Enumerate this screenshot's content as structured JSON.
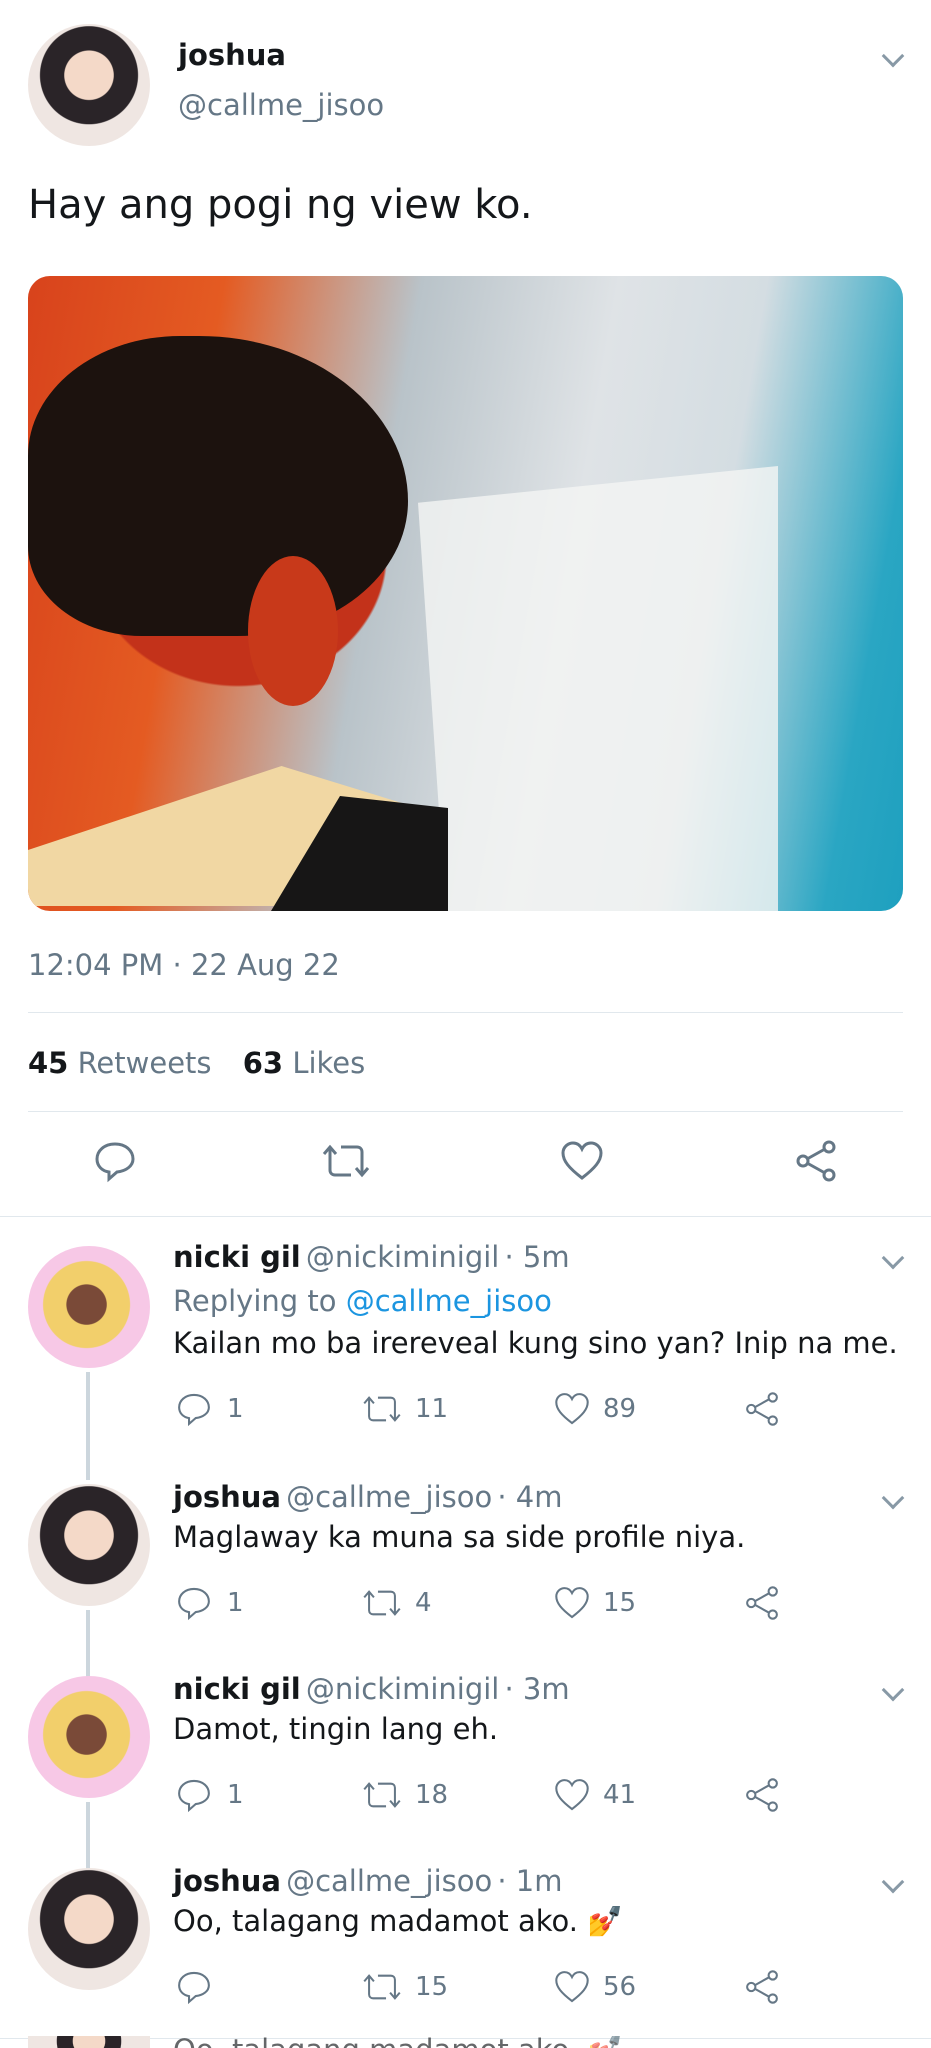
{
  "main_tweet": {
    "name": "joshua",
    "handle": "@callme_jisoo",
    "text": "Hay ang pogi ng view ko.",
    "timestamp": "12:04 PM · 22 Aug 22",
    "retweets_count": "45",
    "retweets_label": "Retweets",
    "likes_count": "63",
    "likes_label": "Likes"
  },
  "icons": {
    "reply": "speech-bubble-icon",
    "retweet": "retweet-icon",
    "like": "heart-icon",
    "share": "share-icon",
    "menu": "chevron-down-icon"
  },
  "replies": [
    {
      "name": "nicki gil",
      "handle": "@nickiminigil",
      "time": "· 5m",
      "replying_label": "Replying to",
      "replying_to": "@callme_jisoo",
      "text": "Kailan mo ba irereveal kung sino yan? Inip na me.",
      "replies": "1",
      "retweets": "11",
      "likes": "89"
    },
    {
      "name": "joshua",
      "handle": "@callme_jisoo",
      "time": "· 4m",
      "text": "Maglaway ka muna sa side profile niya.",
      "replies": "1",
      "retweets": "4",
      "likes": "15"
    },
    {
      "name": "nicki gil",
      "handle": "@nickiminigil",
      "time": "· 3m",
      "text": "Damot, tingin lang eh.",
      "replies": "1",
      "retweets": "18",
      "likes": "41"
    },
    {
      "name": "joshua",
      "handle": "@callme_jisoo",
      "time": "· 1m",
      "text": "Oo, talagang madamot ako. 💅",
      "replies": "",
      "retweets": "15",
      "likes": "56"
    }
  ],
  "cut_off_text": "Oo, talagang madamot ako. 💅"
}
